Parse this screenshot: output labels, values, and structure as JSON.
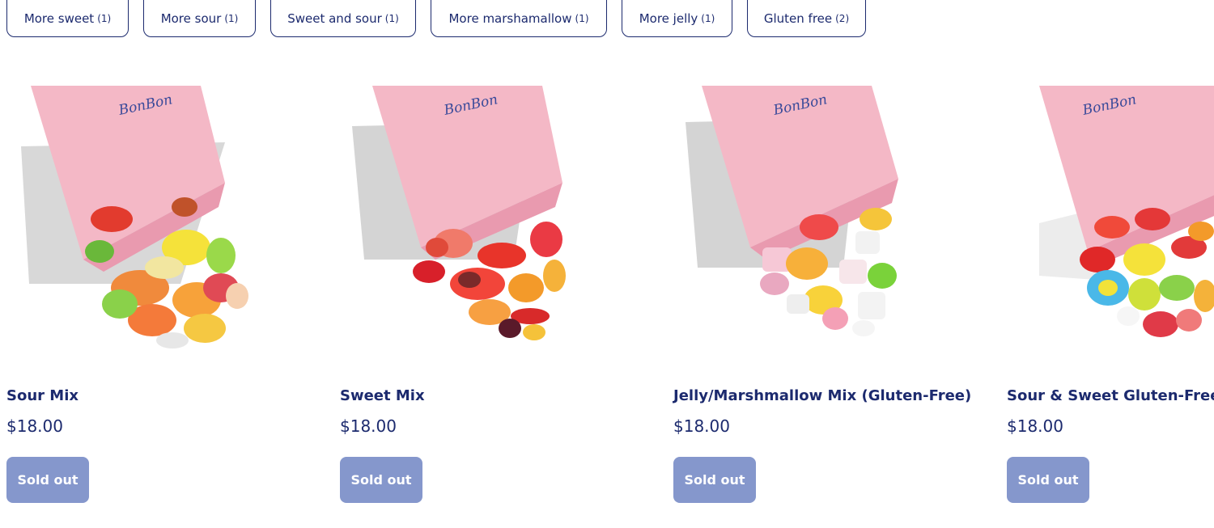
{
  "filters": [
    {
      "label": "More sweet",
      "count": "(1)"
    },
    {
      "label": "More sour",
      "count": "(1)"
    },
    {
      "label": "Sweet and sour",
      "count": "(1)"
    },
    {
      "label": "More marshamallow",
      "count": "(1)"
    },
    {
      "label": "More jelly",
      "count": "(1)"
    },
    {
      "label": "Gluten free",
      "count": "(2)"
    }
  ],
  "products": [
    {
      "title": "Sour Mix",
      "price": "$18.00",
      "button": "Sold out",
      "bag_brand": "BonBon"
    },
    {
      "title": "Sweet Mix",
      "price": "$18.00",
      "button": "Sold out",
      "bag_brand": "BonBon"
    },
    {
      "title": "Jelly/Marshmallow Mix (Gluten-Free)",
      "price": "$18.00",
      "button": "Sold out",
      "bag_brand": "BonBon"
    },
    {
      "title": "Sour & Sweet Gluten-Free Mix",
      "price": "$18.00",
      "button": "Sold out",
      "bag_brand": "BonBon"
    }
  ],
  "colors": {
    "text": "#1c2a6e",
    "sold_out_bg": "#8597cc",
    "bag_pink": "#f4b8c6"
  }
}
